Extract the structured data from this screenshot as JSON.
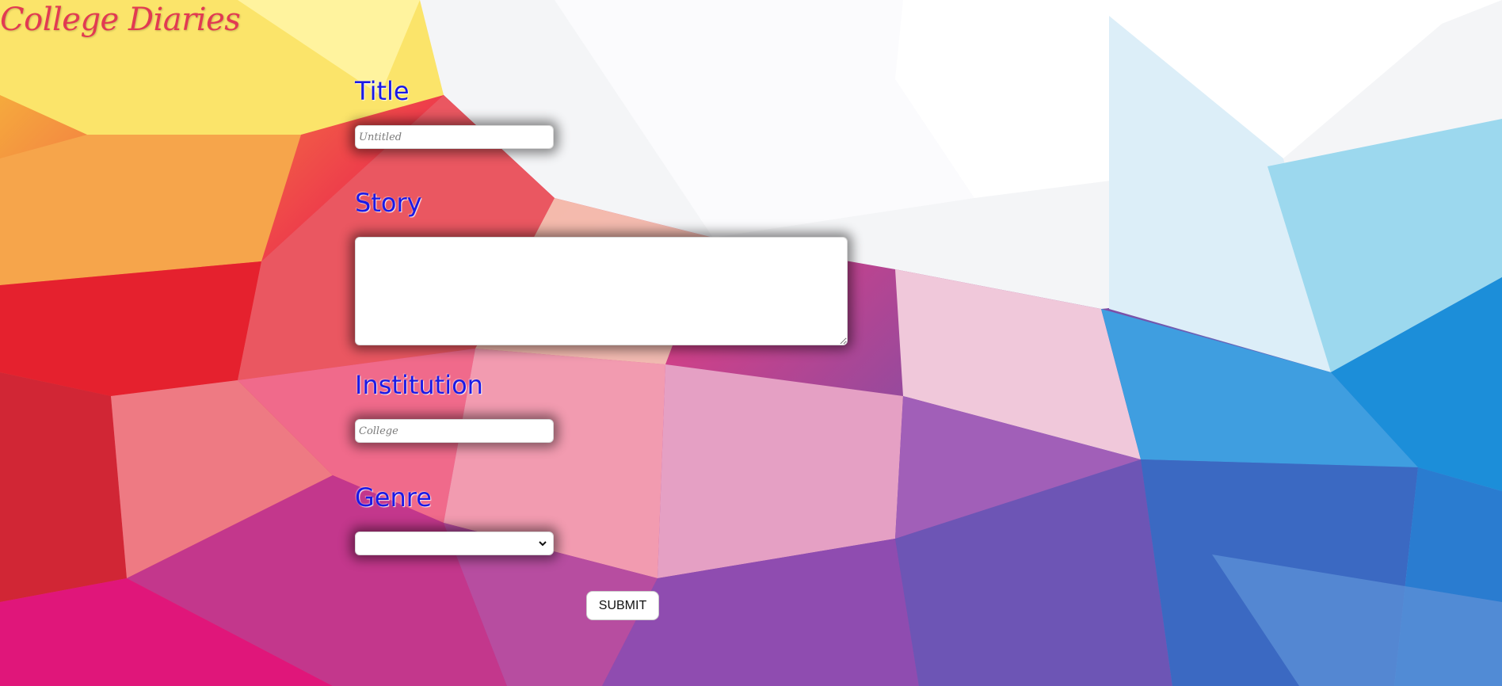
{
  "brand": {
    "title": "College Diaries"
  },
  "form": {
    "title": {
      "label": "Title",
      "placeholder": "Untitled",
      "value": ""
    },
    "story": {
      "label": "Story",
      "placeholder": "",
      "value": ""
    },
    "institution": {
      "label": "Institution",
      "placeholder": "College",
      "value": ""
    },
    "genre": {
      "label": "Genre",
      "selected": ""
    },
    "submit_label": "SUBMIT"
  },
  "colors": {
    "label": "#1a1ae6",
    "brand": "#e23a52"
  },
  "icons": {
    "dropdown": "chevron-down-icon"
  }
}
